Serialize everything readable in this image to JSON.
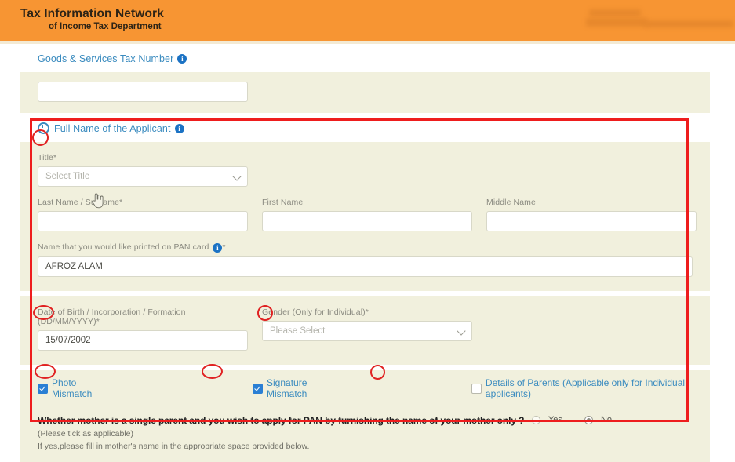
{
  "header": {
    "brand_line1": "Tax Information Network",
    "brand_line2": "of Income Tax Department",
    "right_redacted": ""
  },
  "gst_section": {
    "legend": "Goods & Services Tax Number",
    "info_icon": "info-icon",
    "field_value": "",
    "field_placeholder": ""
  },
  "name_section": {
    "legend": "Full Name of the Applicant",
    "info_icon": "info-icon",
    "title": {
      "label": "Title",
      "required_mark": "*",
      "value": "Select Title",
      "chevron_icon": "chevron-down-icon"
    },
    "last_name": {
      "label": "Last Name / Surname",
      "required_mark": "*",
      "value": ""
    },
    "first_name": {
      "label": "First Name",
      "value": ""
    },
    "middle_name": {
      "label": "Middle Name",
      "value": ""
    },
    "pan_name": {
      "label": "Name that you would like printed on PAN card",
      "required_mark": "*",
      "value": "AFROZ ALAM",
      "info_icon": "info-icon"
    },
    "dob": {
      "label": "Date of Birth / Incorporation / Formation (DD/MM/YYYY)",
      "required_mark": "*",
      "value": "15/07/2002"
    },
    "gender": {
      "label": "Gender (Only for Individual)",
      "required_mark": "*",
      "value": "Please Select",
      "chevron_icon": "chevron-down-icon"
    }
  },
  "mismatch_row": {
    "photo_mismatch": {
      "label": "Photo Mismatch",
      "checked": true
    },
    "signature_mismatch": {
      "label": "Signature Mismatch",
      "checked": true
    },
    "details_of_parents": {
      "label": "Details of Parents (Applicable only for Individual applicants)",
      "checked": false
    }
  },
  "mother_question": {
    "main": "Whether mother is a single parent and you wish to apply for PAN by furnishing the name of your mother only ?",
    "sub1": "(Please tick as applicable)",
    "sub2": "If yes,please fill in mother's name in the appropriate space provided below.",
    "yes_label": "Yes",
    "no_label": "No",
    "selected": "No"
  },
  "colors": {
    "header_orange": "#f79533",
    "panel_beige": "#f1f0dd",
    "link_blue": "#3a8bbf",
    "info_blue": "#1b72c4",
    "annotation_red": "#ee1d1d",
    "checkbox_blue": "#2a7fd4"
  }
}
